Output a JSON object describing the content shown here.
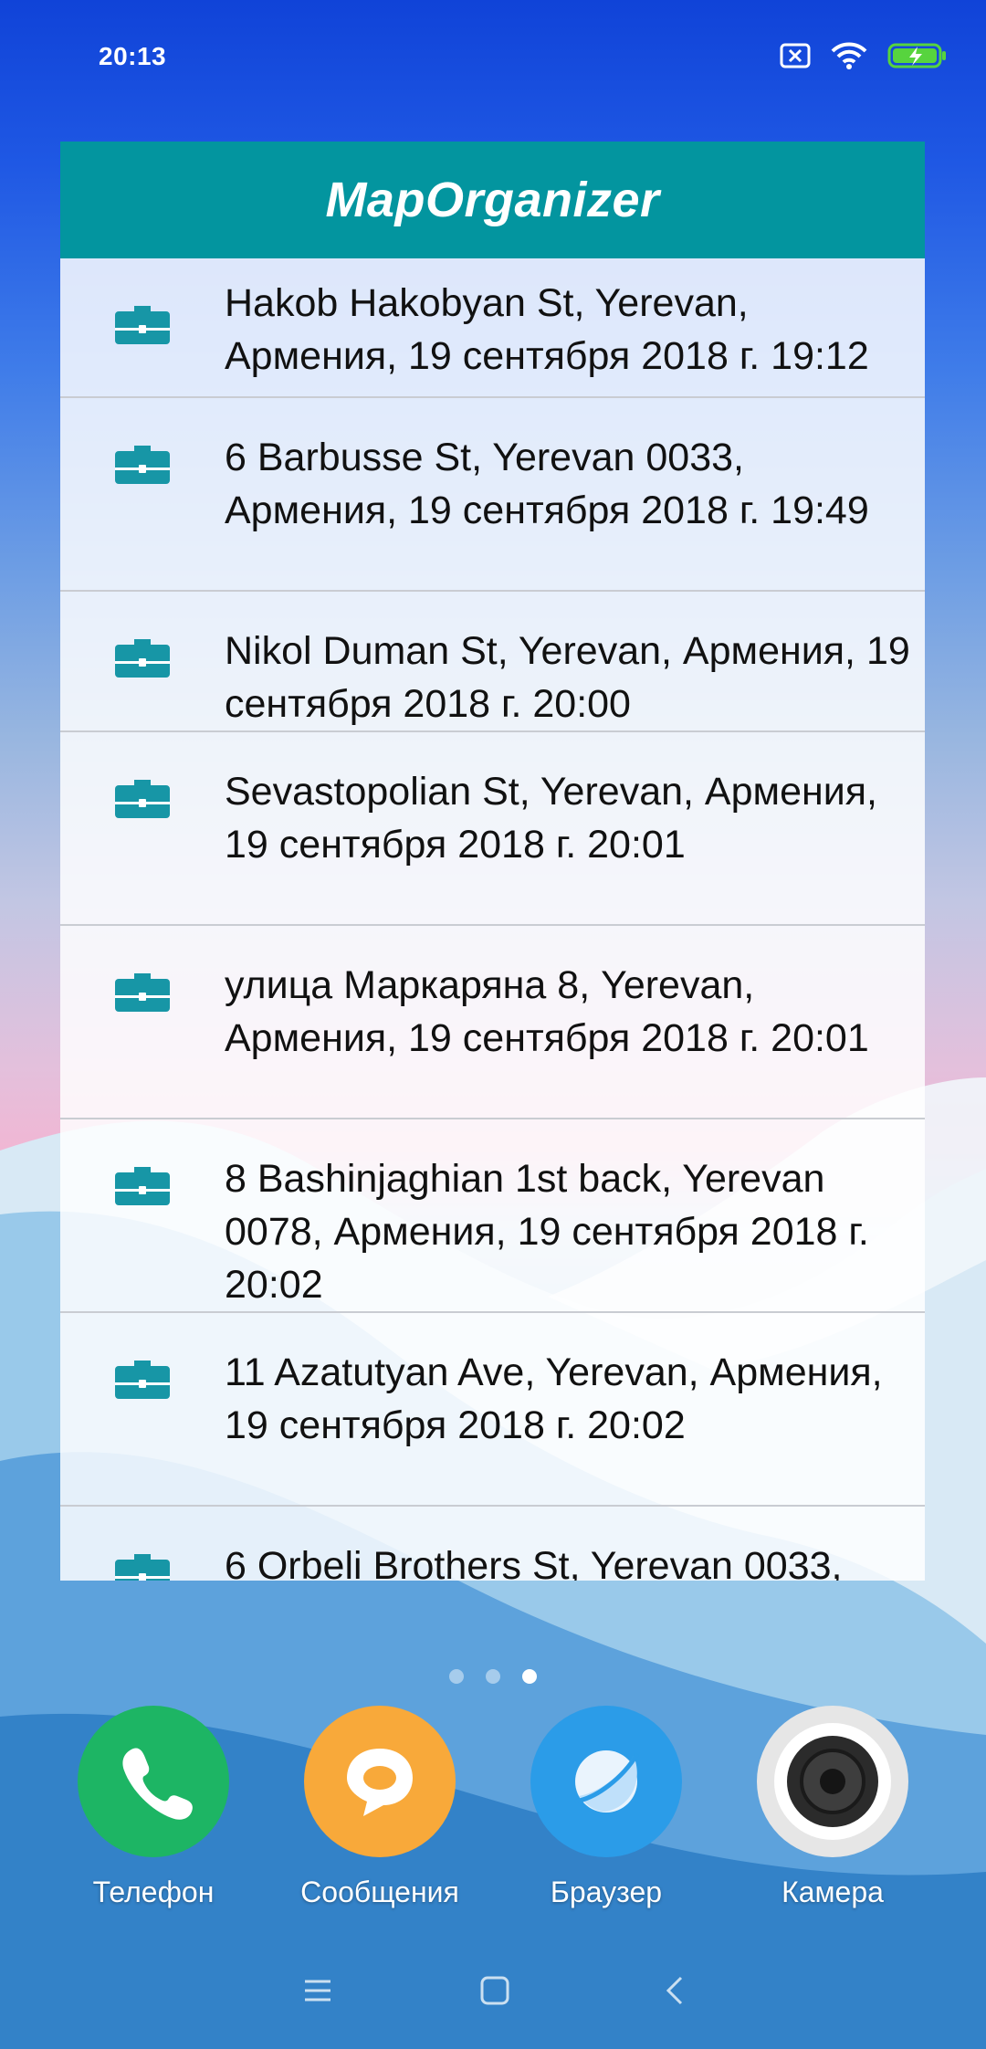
{
  "status_bar": {
    "time": "20:13",
    "icons": [
      "sim-off-icon",
      "wifi-icon",
      "battery-charging-icon"
    ]
  },
  "widget": {
    "title": "MapOrganizer",
    "accent_color": "#03959f",
    "items": [
      {
        "icon": "briefcase-icon",
        "text": "Hakob Hakobyan St, Yerevan, Армения, 19 сентября 2018 г. 19:12"
      },
      {
        "icon": "briefcase-icon",
        "text": "6 Barbusse St, Yerevan 0033, Армения, 19 сентября 2018 г. 19:49"
      },
      {
        "icon": "briefcase-icon",
        "text": "Nikol Duman St, Yerevan, Армения, 19 сентября 2018 г. 20:00"
      },
      {
        "icon": "briefcase-icon",
        "text": "Sevastopolian St, Yerevan, Армения, 19 сентября 2018 г. 20:01"
      },
      {
        "icon": "briefcase-icon",
        "text": "улица Маркаряна 8, Yerevan, Армения, 19 сентября 2018 г. 20:01"
      },
      {
        "icon": "briefcase-icon",
        "text": "8 Bashinjaghian 1st back, Yerevan 0078, Армения, 19 сентября 2018 г. 20:02"
      },
      {
        "icon": "briefcase-icon",
        "text": "11 Azatutyan Ave, Yerevan, Армения, 19 сентября 2018 г. 20:02"
      },
      {
        "icon": "briefcase-icon",
        "text": "6 Orbeli Brothers St, Yerevan 0033,"
      }
    ]
  },
  "page_indicator": {
    "total": 3,
    "active": 3
  },
  "dock": {
    "apps": [
      {
        "label": "Телефон",
        "icon": "phone-icon",
        "color": "#1db564"
      },
      {
        "label": "Сообщения",
        "icon": "message-icon",
        "color": "#f8a93a"
      },
      {
        "label": "Браузер",
        "icon": "browser-icon",
        "color": "#2b9ce8"
      },
      {
        "label": "Камера",
        "icon": "camera-icon",
        "color": "#e6e6e6"
      }
    ]
  },
  "navbar": {
    "icons": [
      "menu-icon",
      "home-icon",
      "back-icon"
    ]
  }
}
